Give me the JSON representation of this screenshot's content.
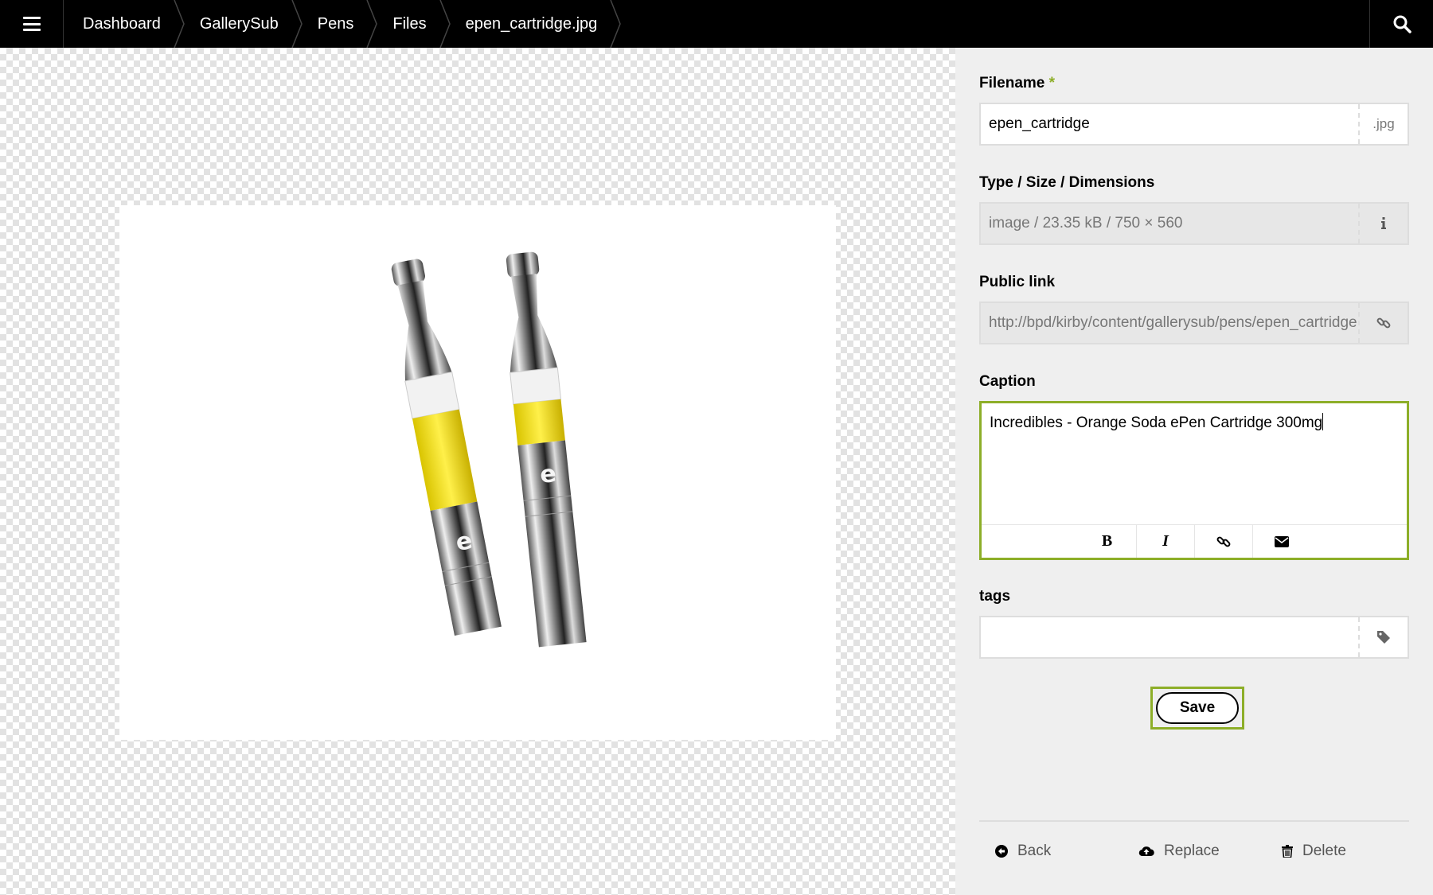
{
  "topbar": {
    "menu_icon": "hamburger-icon",
    "search_icon": "search-icon",
    "breadcrumbs": [
      "Dashboard",
      "GallerySub",
      "Pens",
      "Files",
      "epen_cartridge.jpg"
    ]
  },
  "form": {
    "filename": {
      "label": "Filename",
      "required_mark": "*",
      "value": "epen_cartridge",
      "extension": ".jpg"
    },
    "type_size": {
      "label": "Type / Size / Dimensions",
      "value": "image / 23.35 kB / 750 × 560",
      "icon": "info-icon"
    },
    "public_link": {
      "label": "Public link",
      "value": "http://bpd/kirby/content/gallerysub/pens/epen_cartridge.jpg",
      "icon": "link-icon"
    },
    "caption": {
      "label": "Caption",
      "value": "Incredibles - Orange Soda ePen Cartridge 300mg",
      "toolbar": [
        {
          "name": "bold",
          "glyph": "B"
        },
        {
          "name": "italic",
          "glyph": "I"
        },
        {
          "name": "link",
          "icon": "link-icon"
        },
        {
          "name": "email",
          "icon": "envelope-icon"
        }
      ]
    },
    "tags": {
      "label": "tags",
      "value": "",
      "icon": "tag-icon"
    },
    "save_label": "Save"
  },
  "actions": {
    "back": "Back",
    "replace": "Replace",
    "delete": "Delete"
  },
  "colors": {
    "accent": "#8dae28",
    "topbar_bg": "#000000",
    "sidebar_bg": "#efefef"
  }
}
